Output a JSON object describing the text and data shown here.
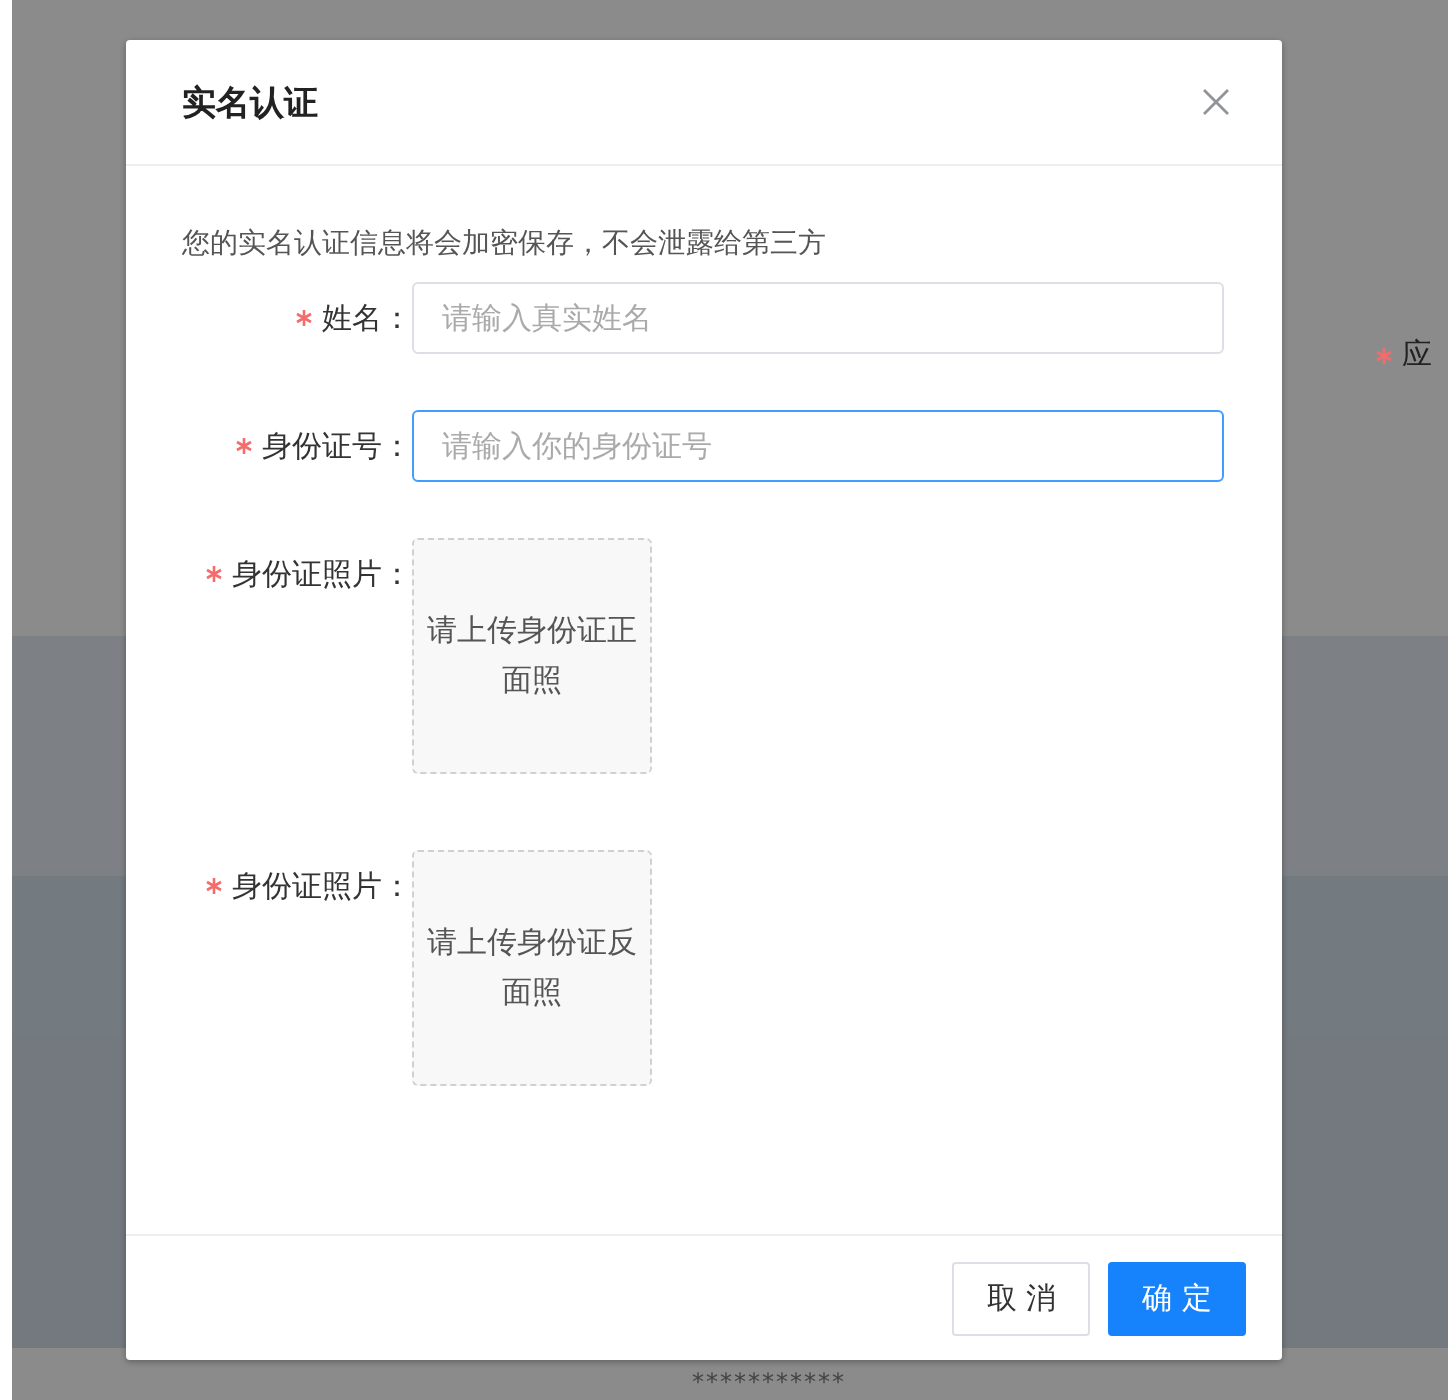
{
  "backdrop": {
    "side_label": {
      "required": true,
      "text": "应"
    },
    "masked_text": "***********"
  },
  "dialog": {
    "title": "实名认证",
    "notice": "您的实名认证信息将会加密保存，不会泄露给第三方",
    "fields": [
      {
        "kind": "input",
        "required": true,
        "label": "姓名：",
        "placeholder": "请输入真实姓名",
        "focused": false
      },
      {
        "kind": "input",
        "required": true,
        "label": "身份证号：",
        "placeholder": "请输入你的身份证号",
        "focused": true
      },
      {
        "kind": "upload",
        "required": true,
        "label": "身份证照片：",
        "hint": "请上传身份证正面照"
      },
      {
        "kind": "upload",
        "required": true,
        "label": "身份证照片：",
        "hint": "请上传身份证反面照"
      }
    ],
    "buttons": [
      {
        "label": "取 消",
        "primary": false
      },
      {
        "label": "确 定",
        "primary": true
      }
    ]
  }
}
